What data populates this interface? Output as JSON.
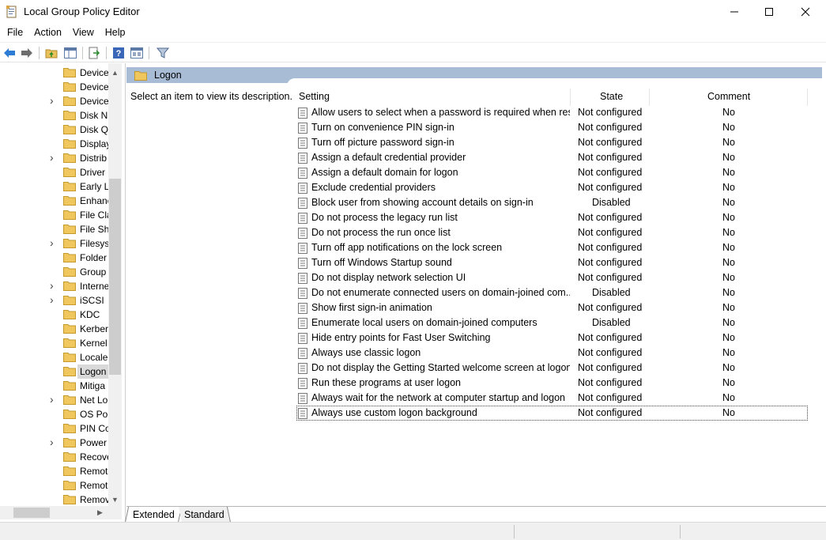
{
  "window": {
    "title": "Local Group Policy Editor",
    "controls": [
      "minimize",
      "maximize",
      "close"
    ]
  },
  "menu": [
    "File",
    "Action",
    "View",
    "Help"
  ],
  "toolbar": [
    "back-arrow-icon",
    "forward-arrow-icon",
    "up-folder-icon",
    "show-hide-tree-icon",
    "export-list-icon",
    "help-icon",
    "properties-icon",
    "filter-icon"
  ],
  "tree": {
    "items": [
      {
        "label": "Device",
        "expandable": false
      },
      {
        "label": "Device",
        "expandable": false
      },
      {
        "label": "Device",
        "expandable": true
      },
      {
        "label": "Disk N",
        "expandable": false
      },
      {
        "label": "Disk Q",
        "expandable": false
      },
      {
        "label": "Display",
        "expandable": false
      },
      {
        "label": "Distrib",
        "expandable": true
      },
      {
        "label": "Driver",
        "expandable": false
      },
      {
        "label": "Early L",
        "expandable": false
      },
      {
        "label": "Enhanc",
        "expandable": false
      },
      {
        "label": "File Cla",
        "expandable": false
      },
      {
        "label": "File Sh",
        "expandable": false
      },
      {
        "label": "Filesys",
        "expandable": true
      },
      {
        "label": "Folder",
        "expandable": false
      },
      {
        "label": "Group",
        "expandable": false
      },
      {
        "label": "Interne",
        "expandable": true
      },
      {
        "label": "iSCSI",
        "expandable": true
      },
      {
        "label": "KDC",
        "expandable": false
      },
      {
        "label": "Kerber",
        "expandable": false
      },
      {
        "label": "Kernel",
        "expandable": false
      },
      {
        "label": "Locale",
        "expandable": false
      },
      {
        "label": "Logon",
        "expandable": false,
        "selected": true
      },
      {
        "label": "Mitiga",
        "expandable": false
      },
      {
        "label": "Net Lo",
        "expandable": true
      },
      {
        "label": "OS Pol",
        "expandable": false
      },
      {
        "label": "PIN Co",
        "expandable": false
      },
      {
        "label": "Power",
        "expandable": true
      },
      {
        "label": "Recove",
        "expandable": false
      },
      {
        "label": "Remot",
        "expandable": false
      },
      {
        "label": "Remot",
        "expandable": false
      },
      {
        "label": "Remov",
        "expandable": false
      }
    ]
  },
  "panel": {
    "folder_title": "Logon",
    "description": "Select an item to view its description."
  },
  "columns": {
    "setting": "Setting",
    "state": "State",
    "comment": "Comment"
  },
  "rows": [
    {
      "setting": "Allow users to select when a password is required when resu...",
      "state": "Not configured",
      "comment": "No"
    },
    {
      "setting": "Turn on convenience PIN sign-in",
      "state": "Not configured",
      "comment": "No"
    },
    {
      "setting": "Turn off picture password sign-in",
      "state": "Not configured",
      "comment": "No"
    },
    {
      "setting": "Assign a default credential provider",
      "state": "Not configured",
      "comment": "No"
    },
    {
      "setting": "Assign a default domain for logon",
      "state": "Not configured",
      "comment": "No"
    },
    {
      "setting": "Exclude credential providers",
      "state": "Not configured",
      "comment": "No"
    },
    {
      "setting": "Block user from showing account details on sign-in",
      "state": "Disabled",
      "comment": "No"
    },
    {
      "setting": "Do not process the legacy run list",
      "state": "Not configured",
      "comment": "No"
    },
    {
      "setting": "Do not process the run once list",
      "state": "Not configured",
      "comment": "No"
    },
    {
      "setting": "Turn off app notifications on the lock screen",
      "state": "Not configured",
      "comment": "No"
    },
    {
      "setting": "Turn off Windows Startup sound",
      "state": "Not configured",
      "comment": "No"
    },
    {
      "setting": "Do not display network selection UI",
      "state": "Not configured",
      "comment": "No"
    },
    {
      "setting": "Do not enumerate connected users on domain-joined com...",
      "state": "Disabled",
      "comment": "No"
    },
    {
      "setting": "Show first sign-in animation",
      "state": "Not configured",
      "comment": "No"
    },
    {
      "setting": "Enumerate local users on domain-joined computers",
      "state": "Disabled",
      "comment": "No"
    },
    {
      "setting": "Hide entry points for Fast User Switching",
      "state": "Not configured",
      "comment": "No"
    },
    {
      "setting": "Always use classic logon",
      "state": "Not configured",
      "comment": "No"
    },
    {
      "setting": "Do not display the Getting Started welcome screen at logon",
      "state": "Not configured",
      "comment": "No"
    },
    {
      "setting": "Run these programs at user logon",
      "state": "Not configured",
      "comment": "No"
    },
    {
      "setting": "Always wait for the network at computer startup and logon",
      "state": "Not configured",
      "comment": "No"
    },
    {
      "setting": "Always use custom logon background",
      "state": "Not configured",
      "comment": "No",
      "focused": true
    }
  ],
  "tabs": {
    "extended": "Extended",
    "standard": "Standard"
  },
  "colors": {
    "header_band": "#a9bcd6",
    "folder_yellow": "#f0c75e",
    "selection": "#d9d9d9"
  }
}
